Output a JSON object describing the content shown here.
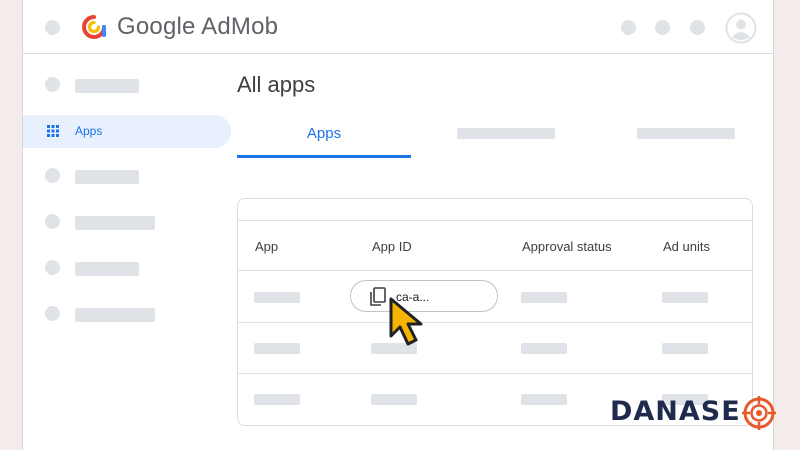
{
  "header": {
    "brand": "Google AdMob",
    "icons": [
      "admob-logo-icon",
      "account-avatar-icon"
    ]
  },
  "sidebar": {
    "active_item": {
      "label": "Apps",
      "icon": "apps-grid-icon"
    }
  },
  "main": {
    "title": "All apps",
    "tabs": [
      {
        "label": "Apps",
        "selected": true
      }
    ]
  },
  "table": {
    "columns": [
      "App",
      "App ID",
      "Approval status",
      "Ad units"
    ],
    "app_id_chip": {
      "text": "ca-a...",
      "icon": "copy-icon"
    }
  },
  "watermark": {
    "text": "DANASE"
  },
  "colors": {
    "accent": "#1a73e8",
    "placeholder": "#dfe3e8",
    "cursor": "#f4b400",
    "watermark_text": "#1f2b4d",
    "watermark_target": "#e8592a"
  }
}
